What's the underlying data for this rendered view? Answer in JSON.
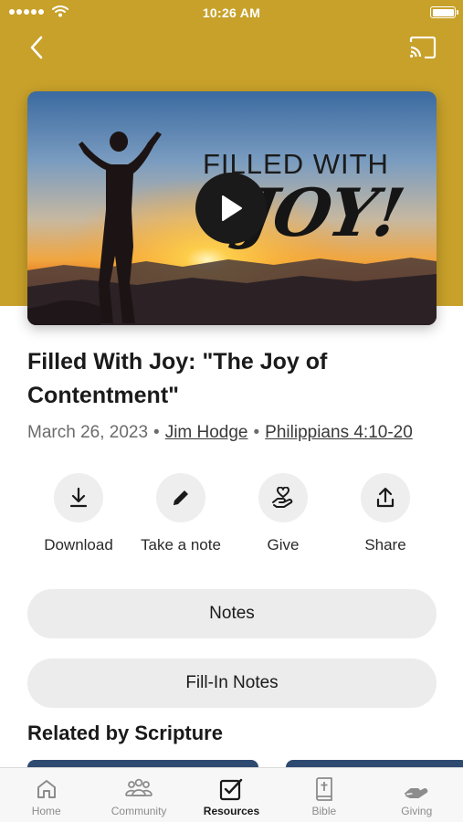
{
  "status_bar": {
    "time": "10:26 AM"
  },
  "header": {
    "back_icon": "chevron-left-icon",
    "cast_icon": "cast-icon",
    "background": "#c8a12a"
  },
  "hero": {
    "image_text_top": "FILLED WITH",
    "image_text_script": "JOY!",
    "play_icon": "play-icon"
  },
  "sermon": {
    "title": "Filled With Joy: \"The Joy of Contentment\"",
    "date": "March 26, 2023",
    "separator": "•",
    "speaker": "Jim Hodge",
    "scripture": "Philippians 4:10-20"
  },
  "actions": [
    {
      "label": "Download",
      "icon": "download-icon"
    },
    {
      "label": "Take a note",
      "icon": "pencil-icon"
    },
    {
      "label": "Give",
      "icon": "give-hand-heart-icon"
    },
    {
      "label": "Share",
      "icon": "share-icon"
    }
  ],
  "buttons": {
    "notes": "Notes",
    "fill_in_notes": "Fill-In Notes"
  },
  "related": {
    "title": "Related by Scripture"
  },
  "tabs": [
    {
      "label": "Home",
      "icon": "home-icon",
      "active": false
    },
    {
      "label": "Community",
      "icon": "community-icon",
      "active": false
    },
    {
      "label": "Resources",
      "icon": "resources-icon",
      "active": true
    },
    {
      "label": "Bible",
      "icon": "bible-icon",
      "active": false
    },
    {
      "label": "Giving",
      "icon": "giving-icon",
      "active": false
    }
  ]
}
